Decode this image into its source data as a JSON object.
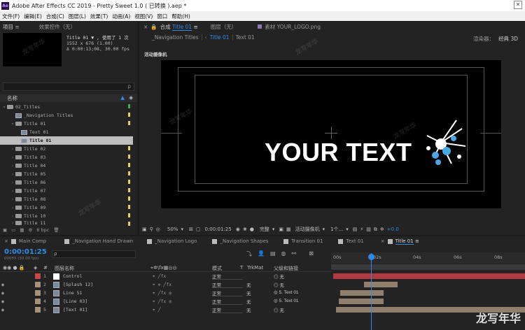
{
  "titlebar": {
    "logo": "Ae",
    "text": "Adobe After Effects CC 2019 - Pretty Sweet 1.0 ( 已转换 ).aep *",
    "close": "✕"
  },
  "menu": [
    "文件(F)",
    "编辑(E)",
    "合成(C)",
    "图层(L)",
    "效果(T)",
    "动画(A)",
    "视图(V)",
    "窗口",
    "帮助(H)"
  ],
  "project": {
    "tab_project": "项目",
    "tab_effects": "效果控件（无）",
    "item_name": "Title 01 ▼ , 使用了 1 次",
    "item_size": "1552 x 676 (1.00)",
    "item_duration": "Δ 0:00:13;08, 30.00 fps",
    "col_name": "名称",
    "rows": [
      "02_Titles",
      "_Navigation Titles",
      "Title 01",
      "Text 01",
      "Title 01",
      "Title 02",
      "Title 03",
      "Title 04",
      "Title 05",
      "Title 06",
      "Title 07",
      "Title 08",
      "Title 09",
      "Title 10",
      "Title 11"
    ],
    "bpc": "8 bpc"
  },
  "comp": {
    "tab_comp": "合成",
    "tab_comp_name": "Title 01",
    "tab_layer": "图层（无）",
    "tab_footage": "素材 YOUR_LOGO.png",
    "crumb1": "_Navigation Titles",
    "crumb2": "Title 01",
    "crumb3": "Text 01",
    "renderer_label": "渲染器：",
    "renderer": "经典 3D",
    "camera_label": "活动摄像机",
    "canvas_text": "YOUR TEXT",
    "zoom": "50%",
    "timecode": "0:00:01:25",
    "quality": "完整",
    "camera": "活动摄像机",
    "views": "1个...",
    "exposure": "+0.0"
  },
  "timeline": {
    "tabs": [
      "Main Comp",
      "_Navigation Hand Drawn",
      "_Navigation Logo",
      "_Navigation Shapes",
      "Transition 01",
      "Text 01",
      "Title 01"
    ],
    "timecode": "0:00:01:25",
    "frames": "00055 (30.00 fps)",
    "search_icon": "ρ",
    "col_layer_name": "图层名称",
    "col_mode": "模式",
    "col_t": "T",
    "col_trkmat": "TrkMat",
    "col_parent": "父级和链接",
    "ruler": [
      "00s",
      "02s",
      "04s",
      "06s",
      "08s"
    ],
    "layers": [
      {
        "num": "1",
        "name": "Control",
        "mode": "正常",
        "trk": "",
        "parent": "无",
        "color": "#c8454a"
      },
      {
        "num": "2",
        "name": "[Splash 12]",
        "mode": "正常",
        "trk": "无",
        "parent": "无",
        "color": "#a6917b"
      },
      {
        "num": "3",
        "name": "Line 51",
        "mode": "正常",
        "trk": "无",
        "parent": "5. Text 01",
        "color": "#a6917b"
      },
      {
        "num": "4",
        "name": "[Line 03]",
        "mode": "正常",
        "trk": "无",
        "parent": "5. Text 01",
        "color": "#a6917b"
      },
      {
        "num": "5",
        "name": "[Text 01]",
        "mode": "正常",
        "trk": "无",
        "parent": "无",
        "color": "#a6917b"
      }
    ]
  },
  "watermark": "龙写年华",
  "colors": {
    "accent": "#2d8ceb",
    "label_red": "#c8454a",
    "label_tan": "#a6917b"
  }
}
